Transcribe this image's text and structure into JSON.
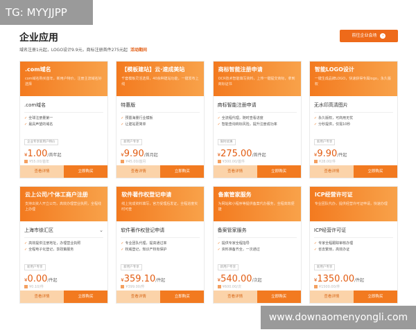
{
  "watermark_top": "TG: MYYJJPP",
  "watermark_bottom": "www.downaomenyongli.com",
  "header": {
    "title": "企业应用",
    "subtitle": "域名注册1元起，LOGO设计9.9元，商标注册首件275元起",
    "subtitle_link": "活动期间",
    "enterprise_button": "前往企业会场",
    "enterprise_arrow": "›"
  },
  "colors": {
    "accent": "#ee6a1a",
    "card_gradient_start": "#f37a1f",
    "card_gradient_end": "#f8a24a"
  },
  "cards": [
    {
      "title": ".com域名",
      "desc": "com域名购买首年，新用户特价，注册主流域名好选择",
      "select": ".com域名",
      "features": [
        "全球注册量第一",
        "最具声望的域名"
      ],
      "promo": "企业专享新用户特价",
      "price": "1.00",
      "unit": "/首年起",
      "orig": "¥55.00/首年"
    },
    {
      "title": "【模板建站】云·速成美站",
      "desc": "千套模板灵活选择，40余种建站功能，一键发布上线",
      "select": "特惠版",
      "features": [
        "预置海量行业模板",
        "让建站更简单"
      ],
      "promo": "新用户专享",
      "price": "9.90",
      "unit": "/首月起",
      "orig": "¥45.00/首月"
    },
    {
      "title": "商标智能注册申请",
      "desc": "OCR技术智能填写资料，上传一键提交商标，拿到商标证书",
      "select": "商标智能注册申请",
      "features": [
        "全流程代理，随时查看进度",
        "智能查询商标风险，提升注册成功率"
      ],
      "promo": "限时优惠",
      "price": "275.00",
      "unit": "/首件起",
      "orig": "¥300.00/首件"
    },
    {
      "title": "智能LOGO设计",
      "desc": "一键生成品牌LOGO，快速获得专属logo，永久版权",
      "select": "无水印高清图片",
      "features": [
        "永久版权，可商用无忧",
        "分秒提供，仅需10秒"
      ],
      "promo": "新用户专享",
      "price": "9.90",
      "unit": "/件起",
      "orig": "¥28.00/件"
    },
    {
      "title": "云上公司/个体工商户注册",
      "desc": "支持出资人开立公司，高效办理营业执照，全程线上办理",
      "select": "上海市徐汇区",
      "chevron": "⌄",
      "features": [
        "高效提供注册地址，办理营业执照",
        "全程电子化登记，享政策服务"
      ],
      "promo": "新用户专享",
      "price": "0.00",
      "unit": "/件起",
      "orig": "¥0.10/件"
    },
    {
      "title": "软件著作权登记申请",
      "desc": "线上完成资料填写，官方受理后发证，全程进度实时可查",
      "select": "软件著作权登记申请",
      "features": [
        "专业团队代理，提高通过率",
        "权威登记，知识产权有保护"
      ],
      "promo": "新用户专享",
      "price": "359.10",
      "unit": "/件起",
      "orig": "¥399.00/件"
    },
    {
      "title": "备案管家服务",
      "desc": "为网站和小程序等提供备案代办服务，全程高效便捷",
      "select": "备案管家服务",
      "features": [
        "提供专家全程指导",
        "资料准备齐全，一次通过"
      ],
      "promo": "新用户专享",
      "price": "540.00",
      "unit": "/次起",
      "orig": "¥600.00/次"
    },
    {
      "title": "ICP经营许可证",
      "desc": "专业团队代办，提供经营许可证申请，快速办理",
      "select": "ICP经营许可证",
      "features": [
        "专家全程跟踪审核办理",
        "省去繁琐，高效办证"
      ],
      "promo": "新用户专享",
      "price": "1350.00",
      "unit": "/件起",
      "orig": "¥1500.00/件"
    }
  ],
  "currency_symbol": "¥",
  "tick_glyph": "✓",
  "detail_label": "查看详情",
  "buy_label": "立即购买"
}
